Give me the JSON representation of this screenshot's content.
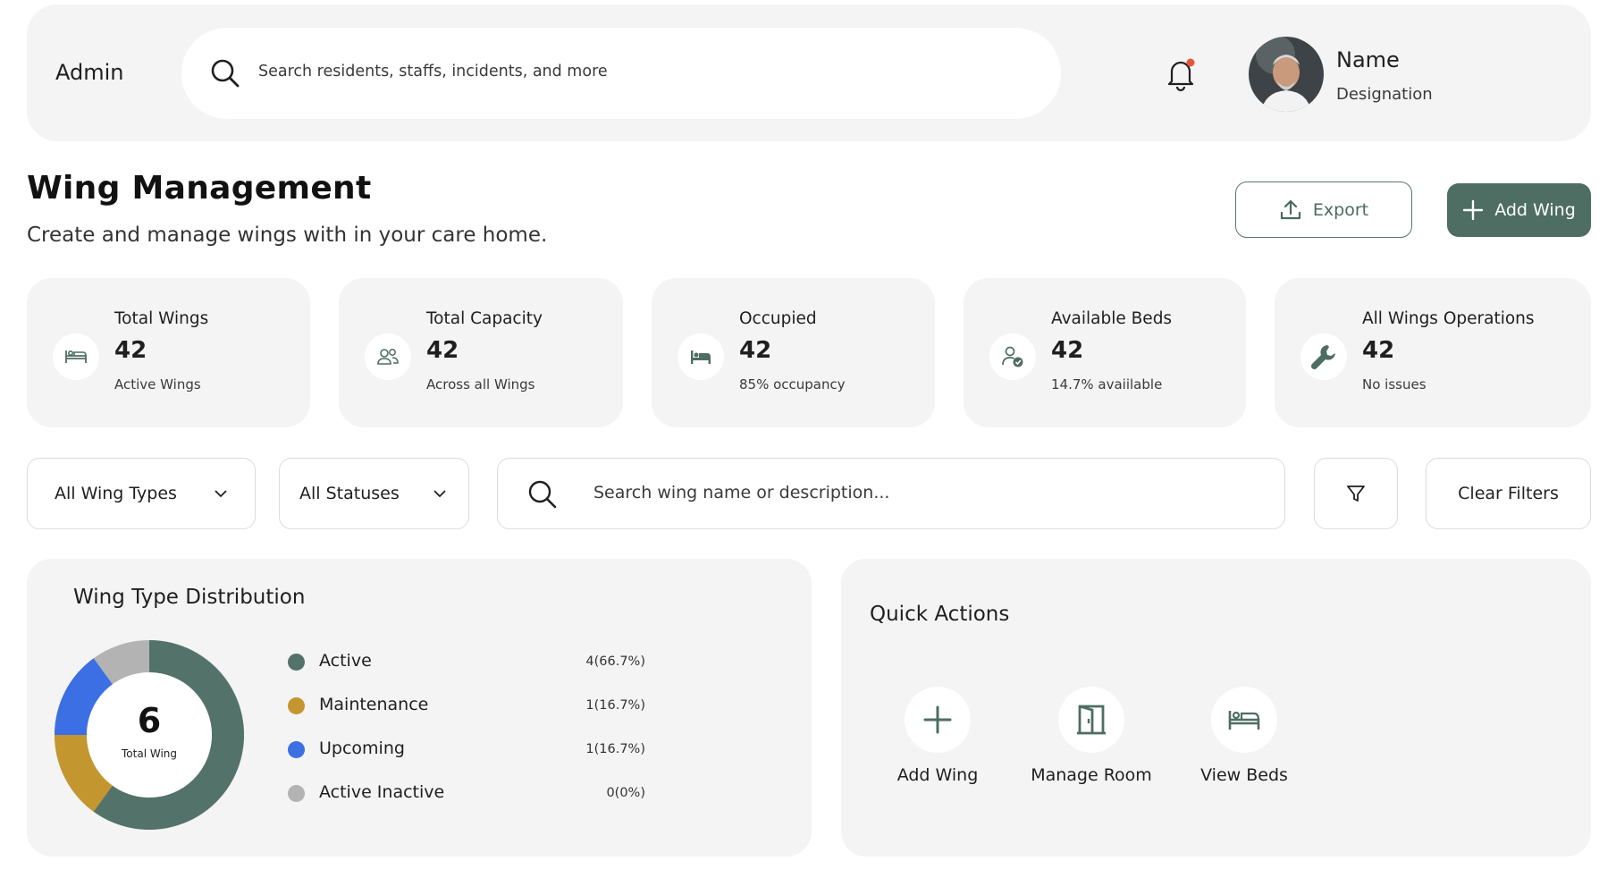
{
  "topbar": {
    "role_label": "Admin",
    "search_placeholder": "Search residents, staffs, incidents, and more",
    "user_name": "Name",
    "user_designation": "Designation",
    "notification_dot_color": "#e4573d"
  },
  "header": {
    "title": "Wing Management",
    "subtitle": "Create and manage wings with in your care home.",
    "export_label": "Export",
    "add_label": "Add Wing"
  },
  "stats": [
    {
      "label": "Total Wings",
      "value": "42",
      "sub": "Active Wings",
      "icon": "bed-outline-icon"
    },
    {
      "label": "Total Capacity",
      "value": "42",
      "sub": "Across all Wings",
      "icon": "users-icon"
    },
    {
      "label": "Occupied",
      "value": "42",
      "sub": "85% occupancy",
      "icon": "bed-filled-icon"
    },
    {
      "label": "Available Beds",
      "value": "42",
      "sub": "14.7% avaiilable",
      "icon": "user-check-icon"
    },
    {
      "label": "All Wings Operations",
      "value": "42",
      "sub": "No issues",
      "icon": "wrench-icon"
    }
  ],
  "filters": {
    "wing_type": "All Wing Types",
    "status": "All Statuses",
    "search_placeholder": "Search wing name or description...",
    "clear_label": "Clear Filters"
  },
  "distribution": {
    "title": "Wing Type Distribution",
    "total": "6",
    "total_caption": "Total Wing",
    "items": [
      {
        "name": "Active",
        "count": "4(66.7%)",
        "color": "#53736a"
      },
      {
        "name": "Maintenance",
        "count": "1(16.7%)",
        "color": "#c4962f"
      },
      {
        "name": "Upcoming",
        "count": "1(16.7%)",
        "color": "#3b6fe3"
      },
      {
        "name": "Active Inactive",
        "count": "0(0%)",
        "color": "#b3b3b3"
      }
    ]
  },
  "chart_data": {
    "type": "pie",
    "categories": [
      "Active",
      "Maintenance",
      "Upcoming",
      "Active Inactive"
    ],
    "values": [
      4,
      1,
      1,
      0
    ]
  },
  "quick_actions": {
    "title": "Quick Actions",
    "items": [
      {
        "label": "Add Wing",
        "icon": "plus-icon"
      },
      {
        "label": "Manage Room",
        "icon": "door-icon"
      },
      {
        "label": "View Beds",
        "icon": "bed-icon"
      }
    ]
  },
  "colors": {
    "accent": "#4e6d63",
    "card_bg": "#f4f4f4"
  }
}
